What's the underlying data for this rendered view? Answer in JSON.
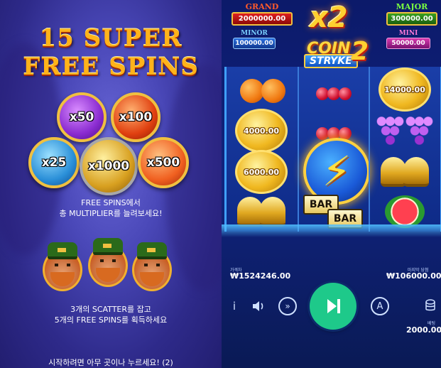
{
  "promo": {
    "title_line1": "15 SUPER",
    "title_line2": "FREE SPINS",
    "multipliers": [
      "x50",
      "x100",
      "x25",
      "x1000",
      "x500"
    ],
    "desc_line1": "FREE SPINS에서",
    "desc_line2": "총 MULTIPLIER를 늘려보세요!",
    "scatter_line1": "3개의 SCATTER를 잡고",
    "scatter_line2": "5개의 FREE SPINS를 획득하세요",
    "continue_text": "시작하려면 아무 곳이나 누르세요! (2)"
  },
  "jackpots": {
    "grand_label": "GRAND",
    "grand_value": "2000000.00",
    "major_label": "MAJOR",
    "major_value": "300000.00",
    "minor_label": "MINOR",
    "minor_value": "100000.00",
    "mini_label": "MINI",
    "mini_value": "50000.00"
  },
  "game": {
    "multiplier": "x2",
    "logo_word1": "COIN",
    "logo_word2": "STRYKE",
    "logo_number": "2"
  },
  "reels": {
    "coin_values": [
      "4000.00",
      "6000.00",
      "14000.00"
    ],
    "bar_text": "BAR"
  },
  "footer": {
    "balance_label": "가격차",
    "balance": "₩1524246.00",
    "win_label": "마지막 당첨",
    "last_win": "₩106000.00",
    "bet_label": "베팅",
    "bet": "2000.00",
    "info_icon_text": "i"
  },
  "colors": {
    "spin_button": "#1ec98a",
    "title_gold": "#ffb31a",
    "reel_bg": "#1a3ea8"
  }
}
